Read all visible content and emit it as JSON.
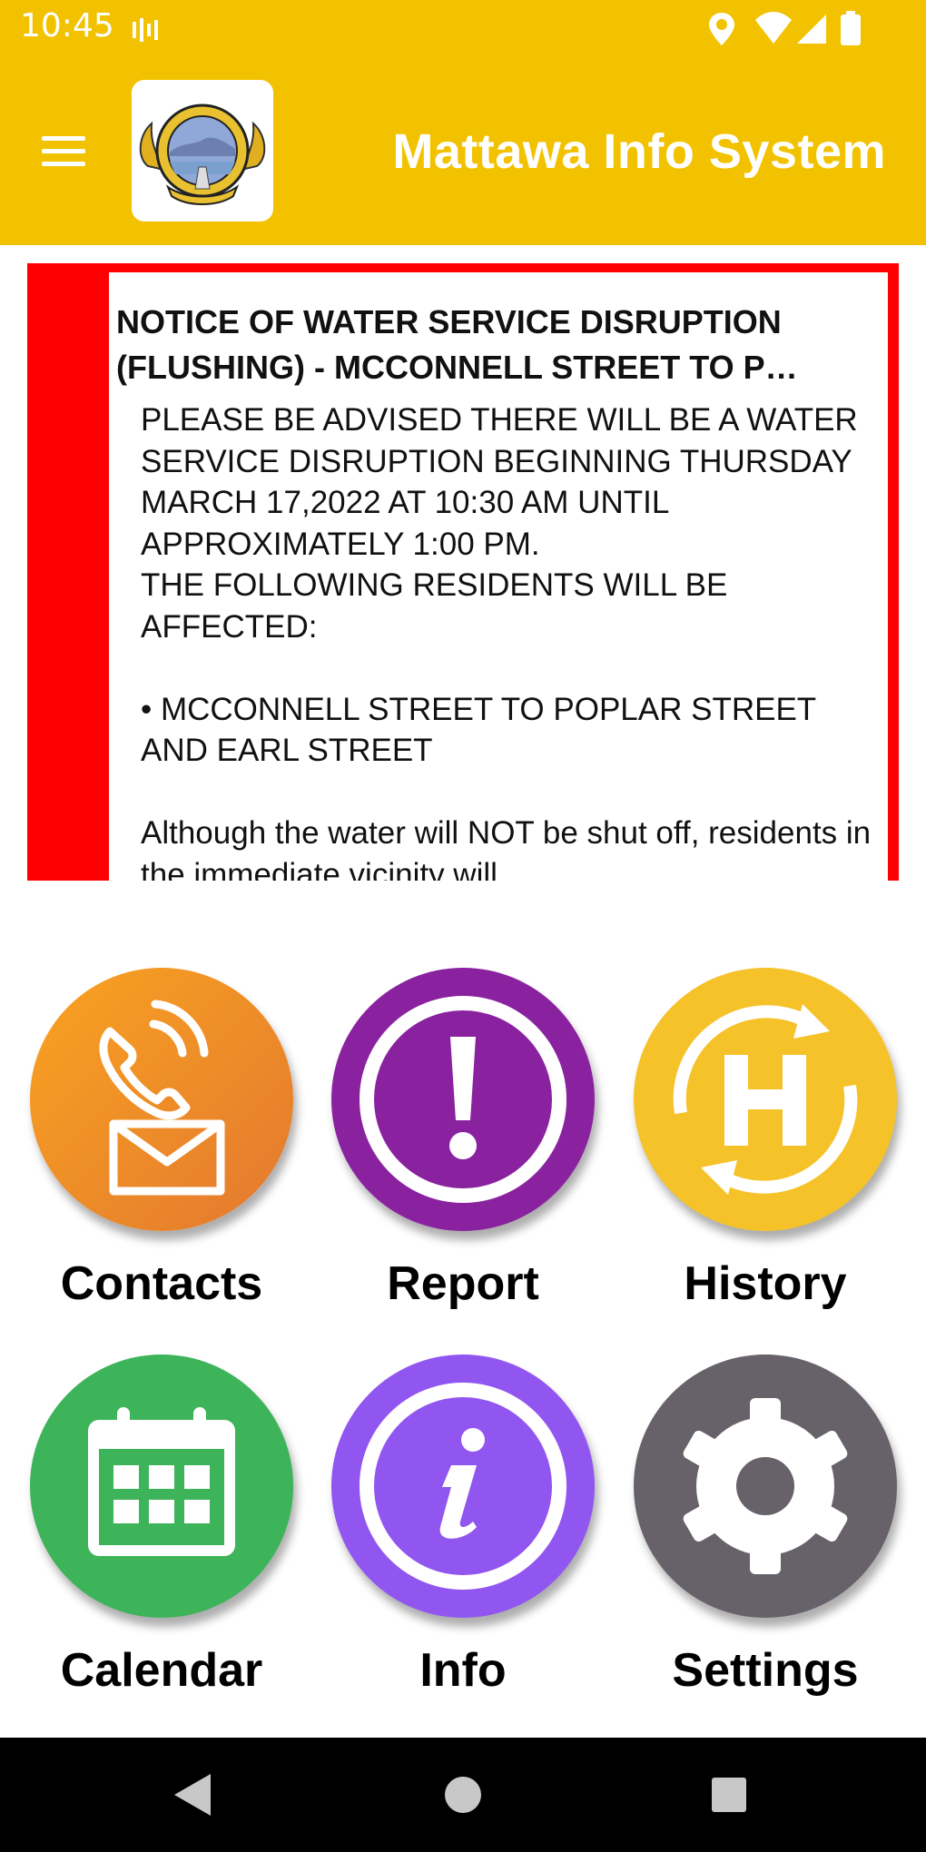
{
  "status_bar": {
    "time": "10:45"
  },
  "app_bar": {
    "title": "Mattawa Info System"
  },
  "notice": {
    "title": "NOTICE OF WATER SERVICE DISRUPTION (FLUSHING) - MCCONNELL STREET TO P…",
    "body": "PLEASE BE ADVISED THERE WILL BE A WATER SERVICE DISRUPTION BEGINNING THURSDAY MARCH 17,2022 AT 10:30 AM UNTIL APPROXIMATELY 1:00 PM.\nTHE FOLLOWING RESIDENTS WILL BE AFFECTED:\n\n• MCCONNELL STREET TO POPLAR STREET AND EARL STREET\n\nAlthough the water will NOT be shut off, residents in the immediate vicinity will",
    "accent_color": "#ff0000"
  },
  "tiles": [
    {
      "label": "Contacts",
      "icon": "phone-mail-icon",
      "color": "#f0902a"
    },
    {
      "label": "Report",
      "icon": "exclamation-icon",
      "color": "#8a22a0"
    },
    {
      "label": "History",
      "icon": "history-h-icon",
      "color": "#f6c22a"
    },
    {
      "label": "Calendar",
      "icon": "calendar-icon",
      "color": "#3db35a"
    },
    {
      "label": "Info",
      "icon": "info-icon",
      "color": "#9256f0"
    },
    {
      "label": "Settings",
      "icon": "gear-icon",
      "color": "#67626a"
    }
  ],
  "colors": {
    "app_bar": "#f2c200",
    "nav_bar": "#000000"
  }
}
